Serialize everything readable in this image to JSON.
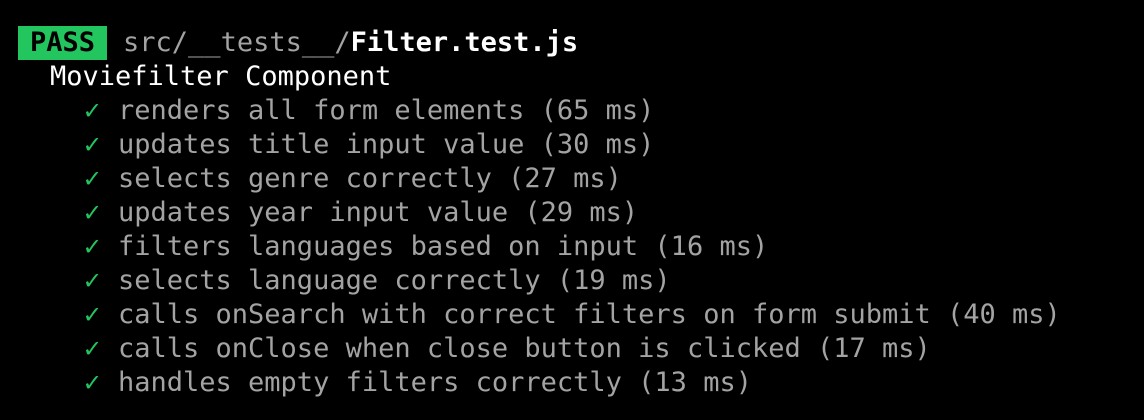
{
  "header": {
    "badge": "PASS",
    "path_prefix": "src/__tests__/",
    "file": "Filter.test.js"
  },
  "suite": {
    "name": "Moviefilter Component"
  },
  "tests": [
    {
      "icon": "✓",
      "text": "renders all form elements (65 ms)"
    },
    {
      "icon": "✓",
      "text": "updates title input value (30 ms)"
    },
    {
      "icon": "✓",
      "text": "selects genre correctly (27 ms)"
    },
    {
      "icon": "✓",
      "text": "updates year input value (29 ms)"
    },
    {
      "icon": "✓",
      "text": "filters languages based on input (16 ms)"
    },
    {
      "icon": "✓",
      "text": "selects language correctly (19 ms)"
    },
    {
      "icon": "✓",
      "text": "calls onSearch with correct filters on form submit (40 ms)"
    },
    {
      "icon": "✓",
      "text": "calls onClose when close button is clicked (17 ms)"
    },
    {
      "icon": "✓",
      "text": "handles empty filters correctly (13 ms)"
    }
  ],
  "colors": {
    "background": "#000000",
    "pass": "#22c55e",
    "dim_text": "#a3a3a3",
    "bright_text": "#ffffff"
  }
}
